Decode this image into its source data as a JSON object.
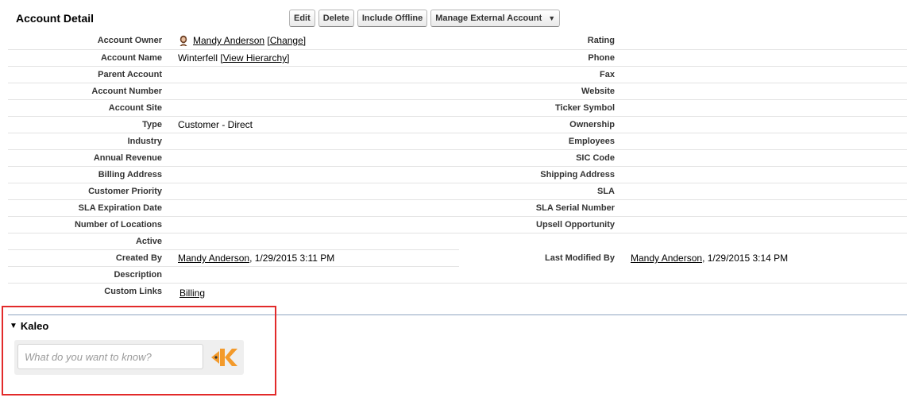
{
  "header": {
    "title": "Account Detail",
    "buttons": [
      "Edit",
      "Delete",
      "Include Offline",
      "Manage External Account"
    ]
  },
  "fields": {
    "account_owner": {
      "label": "Account Owner",
      "name": "Mandy Anderson",
      "action": "[Change]"
    },
    "rating": {
      "label": "Rating"
    },
    "account_name": {
      "label": "Account Name",
      "value": "Winterfell",
      "action": "[View Hierarchy]"
    },
    "phone": {
      "label": "Phone"
    },
    "parent_account": {
      "label": "Parent Account"
    },
    "fax": {
      "label": "Fax"
    },
    "account_number": {
      "label": "Account Number"
    },
    "website": {
      "label": "Website"
    },
    "account_site": {
      "label": "Account Site"
    },
    "ticker_symbol": {
      "label": "Ticker Symbol"
    },
    "type": {
      "label": "Type",
      "value": "Customer - Direct"
    },
    "ownership": {
      "label": "Ownership"
    },
    "industry": {
      "label": "Industry"
    },
    "employees": {
      "label": "Employees"
    },
    "annual_revenue": {
      "label": "Annual Revenue"
    },
    "sic_code": {
      "label": "SIC Code"
    },
    "billing_address": {
      "label": "Billing Address"
    },
    "shipping_address": {
      "label": "Shipping Address"
    },
    "customer_priority": {
      "label": "Customer Priority"
    },
    "sla": {
      "label": "SLA"
    },
    "sla_expiration_date": {
      "label": "SLA Expiration Date"
    },
    "sla_serial_number": {
      "label": "SLA Serial Number"
    },
    "number_of_locations": {
      "label": "Number of Locations"
    },
    "upsell_opportunity": {
      "label": "Upsell Opportunity"
    },
    "active": {
      "label": "Active"
    },
    "created_by": {
      "label": "Created By",
      "name": "Mandy Anderson",
      "date": ", 1/29/2015 3:11 PM"
    },
    "last_modified_by": {
      "label": "Last Modified By",
      "name": "Mandy Anderson",
      "date": ", 1/29/2015 3:14 PM"
    },
    "description": {
      "label": "Description"
    },
    "custom_links": {
      "label": "Custom Links",
      "link": "Billing"
    }
  },
  "kaleo": {
    "title": "Kaleo",
    "placeholder": "What do you want to know?",
    "logo_icon": "kaleo-fish-k-logo",
    "logo_color": "#f39a2b"
  },
  "highlight_color": "#e22a2a"
}
